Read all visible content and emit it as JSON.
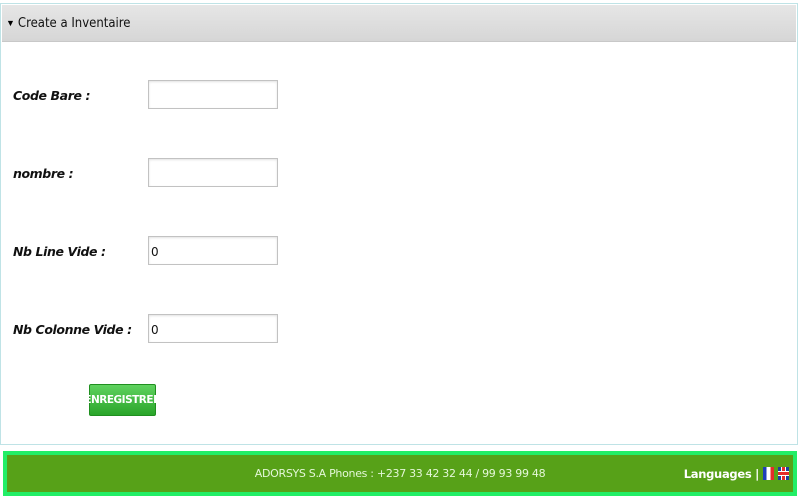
{
  "panel": {
    "caret_icon": "triangle-down",
    "title": "Create a Inventaire"
  },
  "form": {
    "code_bare": {
      "label": "Code Bare :",
      "value": ""
    },
    "nombre": {
      "label": "nombre :",
      "value": ""
    },
    "nb_line_vide": {
      "label": "Nb Line Vide :",
      "value": "0"
    },
    "nb_colonne_vide": {
      "label": "Nb Colonne Vide :",
      "value": "0"
    },
    "submit_label": "ENREGISTRER"
  },
  "footer": {
    "contact": "ADORSYS S.A Phones : +237 33 42 32 44 / 99 93 99 48",
    "languages_label": "Languages |",
    "flags": [
      "french-flag-icon",
      "uk-flag-icon"
    ],
    "colors": {
      "background": "#57a118",
      "border": "#22ee66"
    }
  },
  "colors": {
    "header_bg": "#dcdcdc",
    "button_green": "#3cb83c"
  }
}
